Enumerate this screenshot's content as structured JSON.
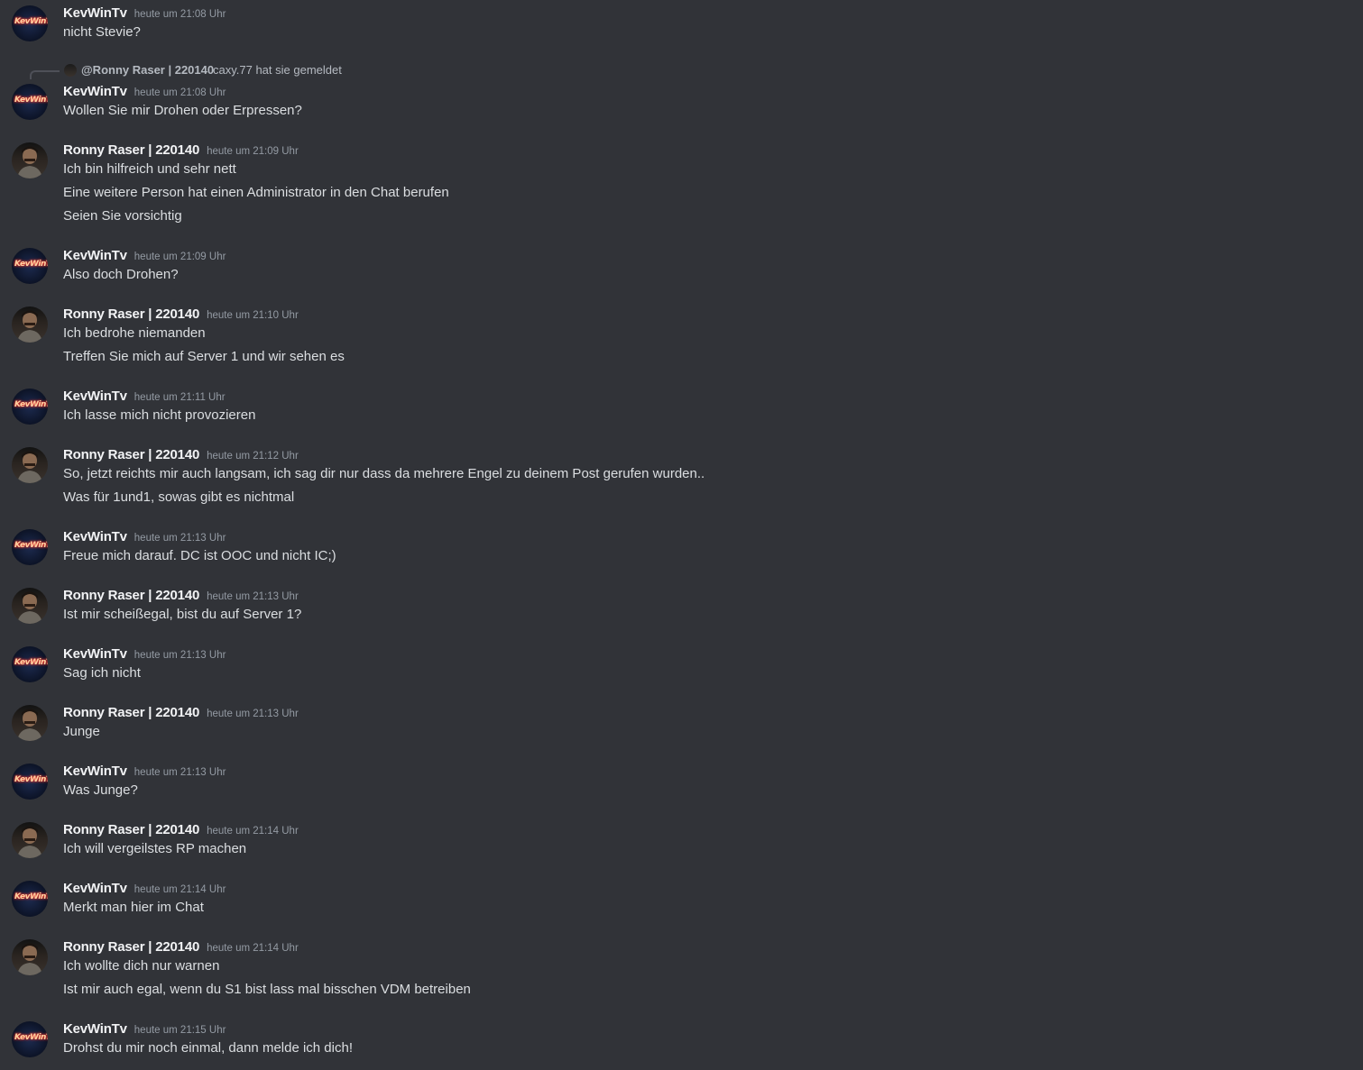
{
  "reply_preview": {
    "name": "@Ronny Raser | 220140",
    "text": "caxy.77 hat sie gemeldet"
  },
  "messages": [
    {
      "user": "KevWinTv",
      "time": "heute um 21:08 Uhr",
      "avatar": "kev",
      "lines": [
        "nicht Stevie?"
      ]
    },
    {
      "user": "KevWinTv",
      "time": "heute um 21:08 Uhr",
      "avatar": "kev",
      "lines": [
        "Wollen Sie mir Drohen oder Erpressen?"
      ]
    },
    {
      "user": "Ronny Raser | 220140",
      "time": "heute um 21:09 Uhr",
      "avatar": "ronny",
      "lines": [
        "Ich bin hilfreich und sehr nett",
        "Eine weitere Person hat einen Administrator in den Chat berufen",
        "Seien Sie vorsichtig"
      ]
    },
    {
      "user": "KevWinTv",
      "time": "heute um 21:09 Uhr",
      "avatar": "kev",
      "lines": [
        "Also doch Drohen?"
      ]
    },
    {
      "user": "Ronny Raser | 220140",
      "time": "heute um 21:10 Uhr",
      "avatar": "ronny",
      "lines": [
        "Ich bedrohe niemanden",
        "Treffen Sie mich auf Server 1 und wir sehen es"
      ]
    },
    {
      "user": "KevWinTv",
      "time": "heute um 21:11 Uhr",
      "avatar": "kev",
      "lines": [
        "Ich lasse mich nicht provozieren"
      ]
    },
    {
      "user": "Ronny Raser | 220140",
      "time": "heute um 21:12 Uhr",
      "avatar": "ronny",
      "lines": [
        "So, jetzt reichts mir auch langsam, ich sag dir nur dass da mehrere Engel zu deinem Post gerufen wurden..",
        "Was für 1und1, sowas gibt es nichtmal"
      ]
    },
    {
      "user": "KevWinTv",
      "time": "heute um 21:13 Uhr",
      "avatar": "kev",
      "lines": [
        "Freue mich darauf. DC ist OOC und nicht IC;)"
      ]
    },
    {
      "user": "Ronny Raser | 220140",
      "time": "heute um 21:13 Uhr",
      "avatar": "ronny",
      "lines": [
        "Ist mir scheißegal, bist du auf Server 1?"
      ]
    },
    {
      "user": "KevWinTv",
      "time": "heute um 21:13 Uhr",
      "avatar": "kev",
      "lines": [
        "Sag ich nicht"
      ]
    },
    {
      "user": "Ronny Raser | 220140",
      "time": "heute um 21:13 Uhr",
      "avatar": "ronny",
      "lines": [
        "Junge"
      ]
    },
    {
      "user": "KevWinTv",
      "time": "heute um 21:13 Uhr",
      "avatar": "kev",
      "lines": [
        "Was Junge?"
      ]
    },
    {
      "user": "Ronny Raser | 220140",
      "time": "heute um 21:14 Uhr",
      "avatar": "ronny",
      "lines": [
        "Ich will vergeilstes RP machen"
      ]
    },
    {
      "user": "KevWinTv",
      "time": "heute um 21:14 Uhr",
      "avatar": "kev",
      "lines": [
        "Merkt man hier im Chat"
      ]
    },
    {
      "user": "Ronny Raser | 220140",
      "time": "heute um 21:14 Uhr",
      "avatar": "ronny",
      "lines": [
        "Ich wollte dich nur warnen",
        "Ist mir auch egal, wenn du S1 bist lass mal bisschen VDM betreiben"
      ]
    },
    {
      "user": "KevWinTv",
      "time": "heute um 21:15 Uhr",
      "avatar": "kev",
      "lines": [
        "Drohst du mir noch einmal, dann melde ich dich!"
      ]
    }
  ]
}
